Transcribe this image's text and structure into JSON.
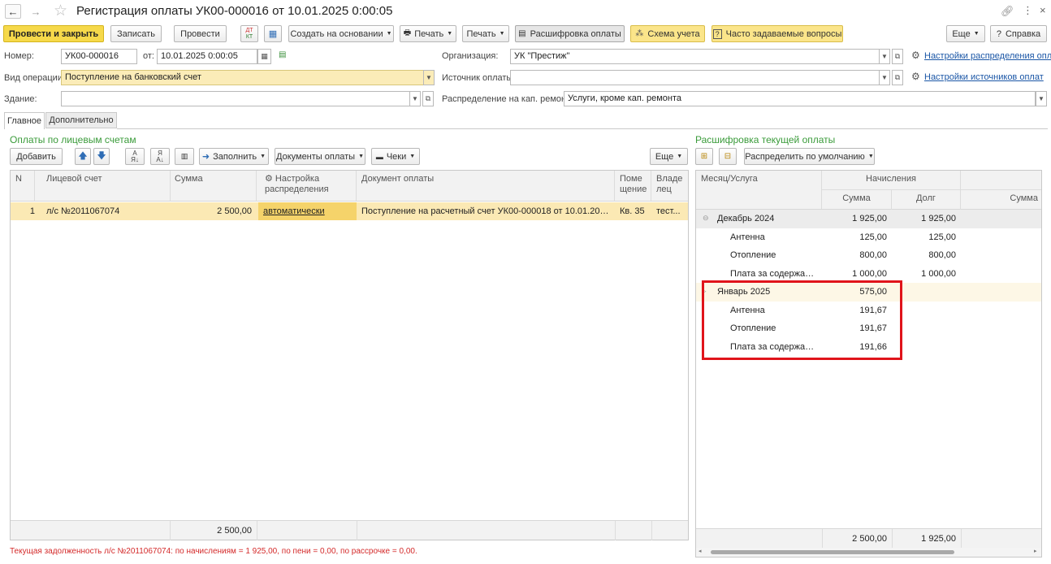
{
  "window": {
    "title": "Регистрация оплаты УК00-000016 от 10.01.2025 0:00:05"
  },
  "toolbar": {
    "post_close": "Провести и закрыть",
    "save": "Записать",
    "post": "Провести",
    "create_based": "Создать на основании",
    "print1": "Печать",
    "print2": "Печать",
    "breakdown": "Расшифровка оплаты",
    "accounting_scheme": "Схема учета",
    "faq": "Часто задаваемые вопросы",
    "more": "Еще",
    "help": "Справка"
  },
  "header": {
    "number_label": "Номер:",
    "number_value": "УК00-000016",
    "date_label": "от:",
    "date_value": "10.01.2025  0:00:05",
    "org_label": "Организация:",
    "org_value": "УК \"Престиж\"",
    "org_link": "Настройки распределения оплат",
    "op_label": "Вид операции:",
    "op_value": "Поступление на банковский счет",
    "source_label": "Источник оплаты:",
    "source_value": "",
    "source_link": "Настройки источников оплат",
    "building_label": "Здание:",
    "building_value": "",
    "capital_label": "Распределение на кап. ремонт:",
    "capital_value": "Услуги, кроме кап. ремонта"
  },
  "tabs": [
    "Главное",
    "Дополнительно"
  ],
  "left": {
    "title": "Оплаты по лицевым счетам",
    "add": "Добавить",
    "fill": "Заполнить",
    "payment_docs": "Документы оплаты",
    "receipts": "Чеки",
    "more": "Еще",
    "columns": {
      "n": "N",
      "account": "Лицевой счет",
      "sum": "Сумма",
      "setting": "Настройка распределения",
      "doc": "Документ оплаты",
      "room": "Поме щение",
      "owner": "Владе лец"
    },
    "rows": [
      {
        "n": "1",
        "account": "л/с №2011067074",
        "sum": "2 500,00",
        "setting": "автоматически",
        "doc": "Поступление на расчетный счет УК00-000018 от 10.01.2025 0:0...",
        "room": "Кв. 35",
        "owner": "тест..."
      }
    ],
    "total_sum": "2 500,00",
    "status": "Текущая задолженность л/с №2011067074: по начислениям = 1 925,00, по пени = 0,00, по рассрочке = 0,00."
  },
  "right": {
    "title": "Расшифровка текущей оплаты",
    "distribute": "Распределить по умолчанию",
    "columns": {
      "service": "Месяц/Услуга",
      "accruals": "Начисления",
      "sum": "Сумма",
      "debt": "Долг",
      "sum2": "Сумма"
    },
    "rows": [
      {
        "name": "Декабрь 2024",
        "sum": "1 925,00",
        "debt": "1 925,00",
        "group": true
      },
      {
        "name": "Антенна",
        "sum": "125,00",
        "debt": "125,00",
        "group": false
      },
      {
        "name": "Отопление",
        "sum": "800,00",
        "debt": "800,00",
        "group": false
      },
      {
        "name": "Плата за содержание...",
        "sum": "1 000,00",
        "debt": "1 000,00",
        "group": false
      },
      {
        "name": "Январь 2025",
        "sum": "575,00",
        "debt": "",
        "group": true
      },
      {
        "name": "Антенна",
        "sum": "191,67",
        "debt": "",
        "group": false
      },
      {
        "name": "Отопление",
        "sum": "191,67",
        "debt": "",
        "group": false
      },
      {
        "name": "Плата за содержание...",
        "sum": "191,66",
        "debt": "",
        "group": false
      }
    ],
    "total_sum": "2 500,00",
    "total_debt": "1 925,00"
  }
}
